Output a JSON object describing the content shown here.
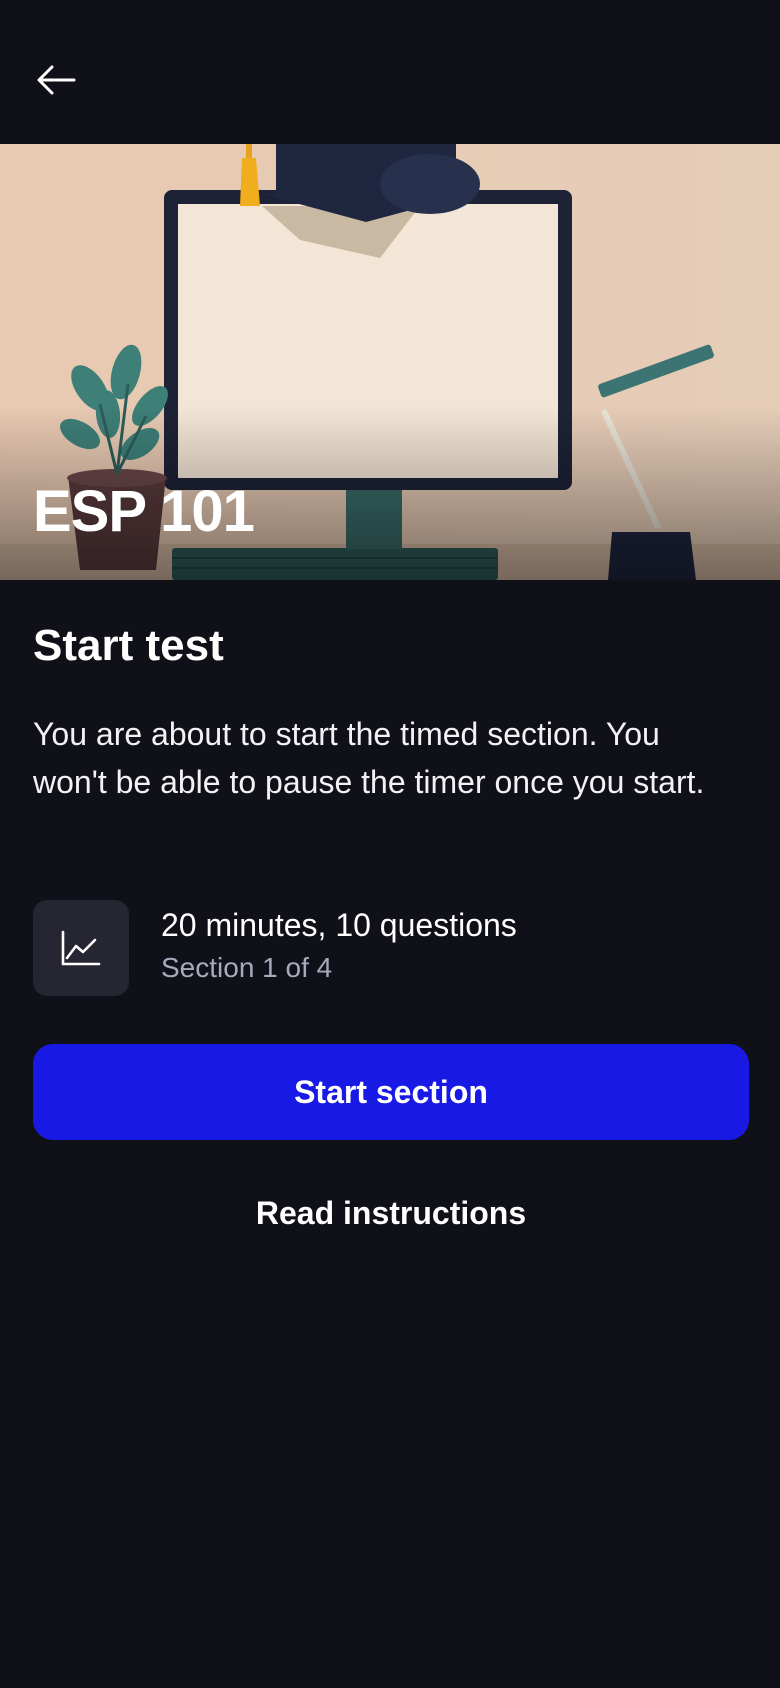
{
  "header": {
    "back_icon": "arrow-left-icon"
  },
  "hero": {
    "course_title": "ESP 101",
    "illustration": "graduation-desk-illustration"
  },
  "main": {
    "heading": "Start test",
    "description": "You are about to start the timed section. You won't be able to pause the timer once you start.",
    "section_info": {
      "icon": "line-chart-icon",
      "primary": "20 minutes, 10 questions",
      "secondary": "Section 1 of 4"
    },
    "start_button_label": "Start section",
    "instructions_label": "Read instructions"
  },
  "colors": {
    "background": "#0f1018",
    "primary_button": "#1919e6",
    "icon_box": "#262633",
    "muted_text": "#a9a9bb"
  }
}
